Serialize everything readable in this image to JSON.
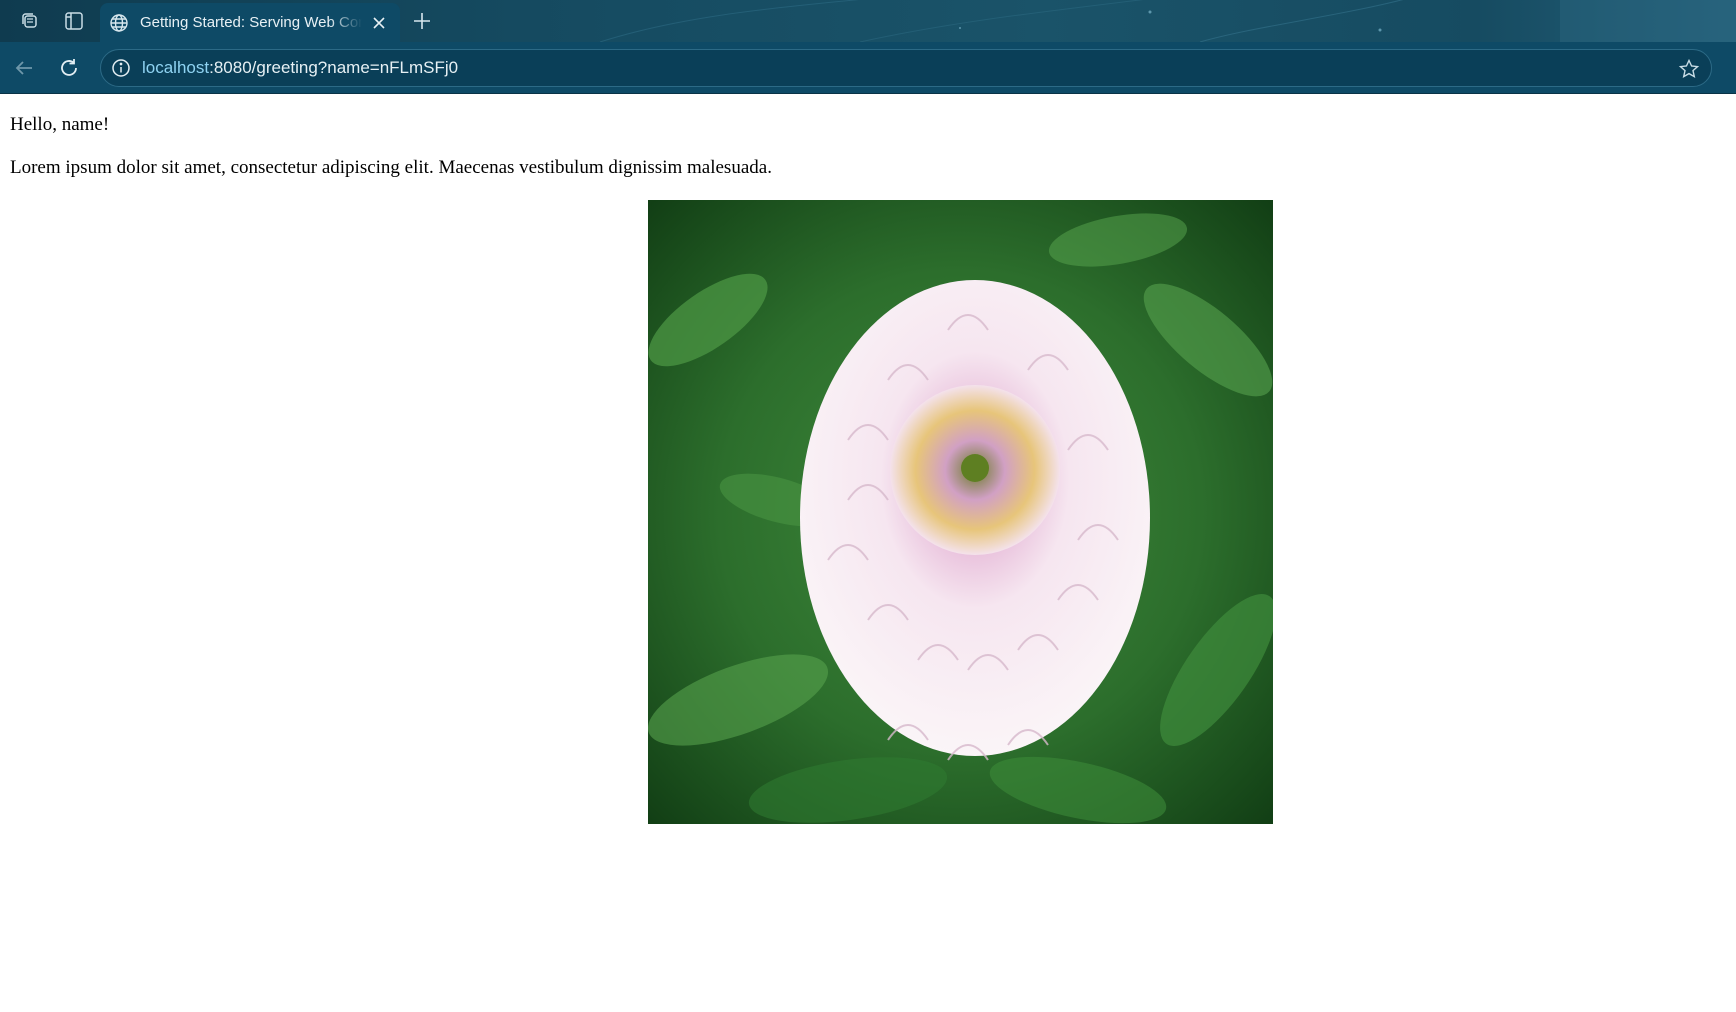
{
  "browser": {
    "tab": {
      "title": "Getting Started: Serving Web Content"
    },
    "address_bar": {
      "host": "localhost",
      "path": ":8080/greeting?name=nFLmSFj0"
    }
  },
  "page": {
    "greeting": "Hello, name!",
    "paragraph": "Lorem ipsum dolor sit amet, consectetur adipiscing elit. Maecenas vestibulum dignissim malesuada."
  },
  "colors": {
    "chrome": "#0e4a66",
    "omnibox": "#0a3f58",
    "host_text": "#8fd3f2"
  },
  "icons": [
    "workspaces-icon",
    "tab-actions-icon",
    "globe-icon",
    "close-icon",
    "plus-icon",
    "back-arrow-icon",
    "reload-icon",
    "info-icon",
    "star-icon"
  ]
}
